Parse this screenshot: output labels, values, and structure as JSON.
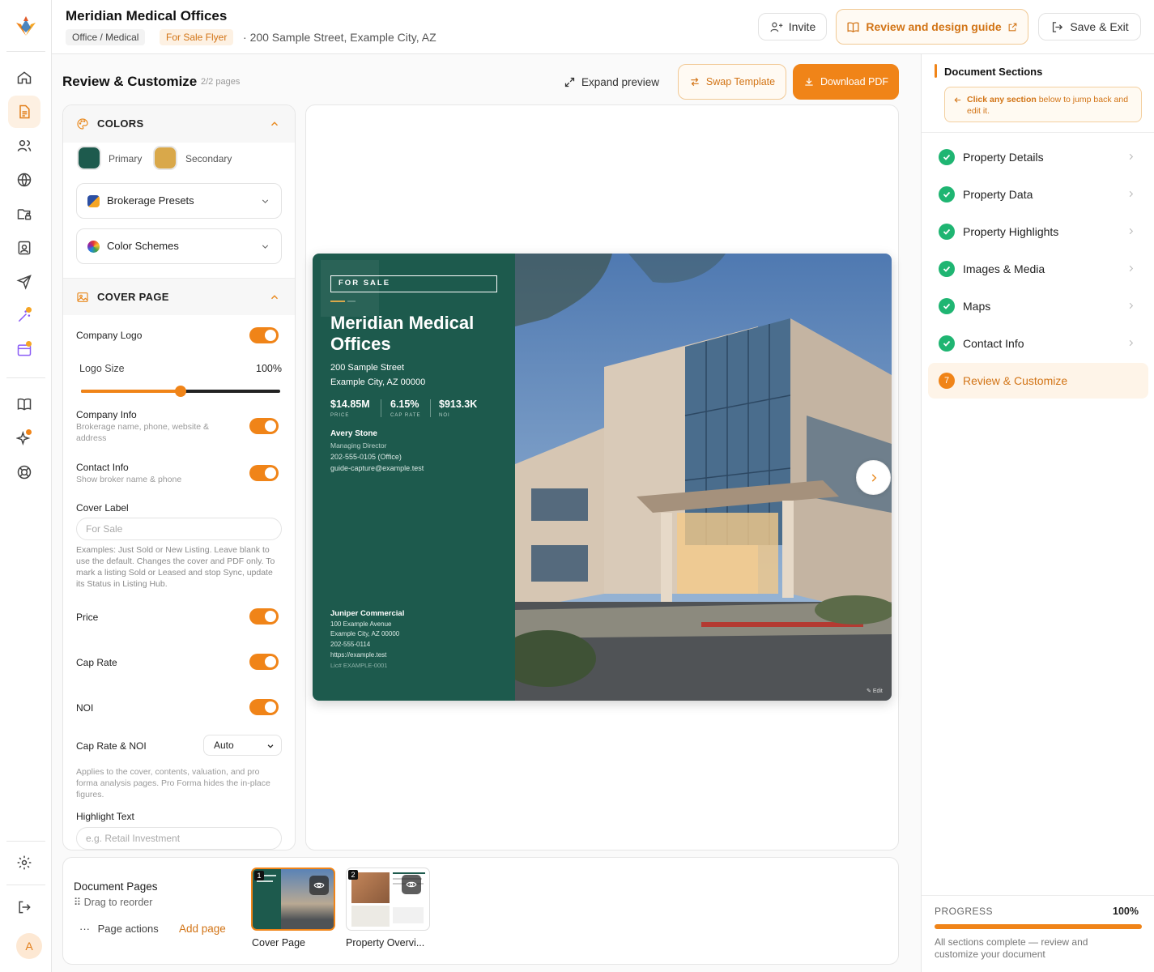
{
  "header": {
    "title": "Meridian Medical Offices",
    "category_chip": "Office / Medical",
    "type_chip": "For Sale Flyer",
    "address": "200 Sample Street, Example City, AZ",
    "invite_label": "Invite",
    "guide_label": "Review and design guide",
    "save_exit_label": "Save & Exit"
  },
  "toolbar": {
    "title": "Review & Customize",
    "page_count": "2/2 pages",
    "expand_label": "Expand preview",
    "swap_label": "Swap Template",
    "download_label": "Download PDF"
  },
  "colors": {
    "section_title": "COLORS",
    "primary_label": "Primary",
    "secondary_label": "Secondary",
    "primary_hex": "#1d5a4d",
    "secondary_hex": "#d9a84a",
    "accent_hex": "#f08418",
    "brokerage_presets_label": "Brokerage Presets",
    "color_schemes_label": "Color Schemes"
  },
  "cover": {
    "section_title": "COVER PAGE",
    "company_logo_label": "Company Logo",
    "logo_size_label": "Logo Size",
    "logo_size_value": "100%",
    "logo_size_fraction": 0.5,
    "company_info_label": "Company Info",
    "company_info_sub": "Brokerage name, phone, website & address",
    "contact_info_label": "Contact Info",
    "contact_info_sub": "Show broker name & phone",
    "cover_label_label": "Cover Label",
    "cover_label_placeholder": "For Sale",
    "cover_label_help": "Examples: Just Sold or New Listing. Leave blank to use the default. Changes the cover and PDF only. To mark a listing Sold or Leased and stop Sync, update its Status in Listing Hub.",
    "price_label": "Price",
    "cap_rate_label": "Cap Rate",
    "noi_label": "NOI",
    "cap_rate_noi_label": "Cap Rate & NOI",
    "cap_rate_noi_value": "Auto",
    "cap_rate_noi_help": "Applies to the cover, contents, valuation, and pro forma analysis pages. Pro Forma hides the in-place figures.",
    "highlight_text_label": "Highlight Text",
    "highlight_text_placeholder": "e.g. Retail Investment"
  },
  "flyer": {
    "for_sale": "FOR SALE",
    "title_line1": "Meridian Medical",
    "title_line2": "Offices",
    "street": "200 Sample Street",
    "city": "Example City, AZ 00000",
    "price_value": "$14.85M",
    "price_key": "PRICE",
    "cap_value": "6.15%",
    "cap_key": "CAP RATE",
    "noi_value": "$913.3K",
    "noi_key": "NOI",
    "agent_name": "Avery Stone",
    "agent_title": "Managing Director",
    "agent_phone": "202-555-0105 (Office)",
    "agent_email": "guide-capture@example.test",
    "company_name": "Juniper Commercial",
    "company_street": "100 Example Avenue",
    "company_city": "Example City, AZ 00000",
    "company_phone": "202-555-0114",
    "company_url": "https://example.test",
    "company_license": "Lic# EXAMPLE-0001",
    "edit_label": "Edit"
  },
  "pages_bar": {
    "title": "Document Pages",
    "drag_hint": "Drag to reorder",
    "page_actions": "Page actions",
    "add_page": "Add page",
    "pages": [
      {
        "number": "1",
        "label": "Cover Page"
      },
      {
        "number": "2",
        "label": "Property Overvi..."
      }
    ]
  },
  "sections": {
    "title": "Document Sections",
    "hint_bold": "Click any section",
    "hint_rest": " below to jump back and edit it.",
    "items": [
      {
        "label": "Property Details"
      },
      {
        "label": "Property Data"
      },
      {
        "label": "Property Highlights"
      },
      {
        "label": "Images & Media"
      },
      {
        "label": "Maps"
      },
      {
        "label": "Contact Info"
      },
      {
        "label": "Review & Customize",
        "number": "7"
      }
    ]
  },
  "progress": {
    "label": "PROGRESS",
    "value": "100%",
    "fraction": 1.0,
    "message": "All sections complete — review and customize your document"
  },
  "user": {
    "initial": "A"
  }
}
